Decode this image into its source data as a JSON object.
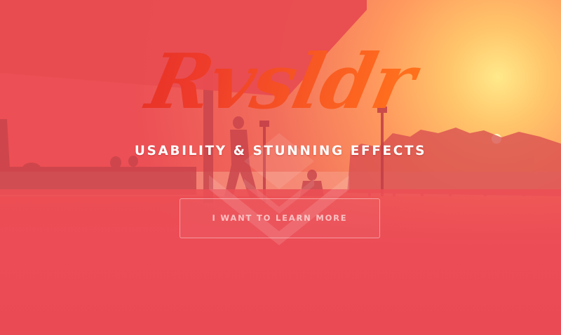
{
  "hero": {
    "brand": "Rvsldr",
    "tagline": "USABILITY & STUNNING EFFECTS",
    "cta_label": "I WANT TO LEARN MORE"
  },
  "colors": {
    "overlay": "#ec4f55",
    "sun": "#ffe98a",
    "brand_gradient_start": "#d81e22",
    "brand_gradient_end": "#ff8b12",
    "text": "#ffffff"
  }
}
